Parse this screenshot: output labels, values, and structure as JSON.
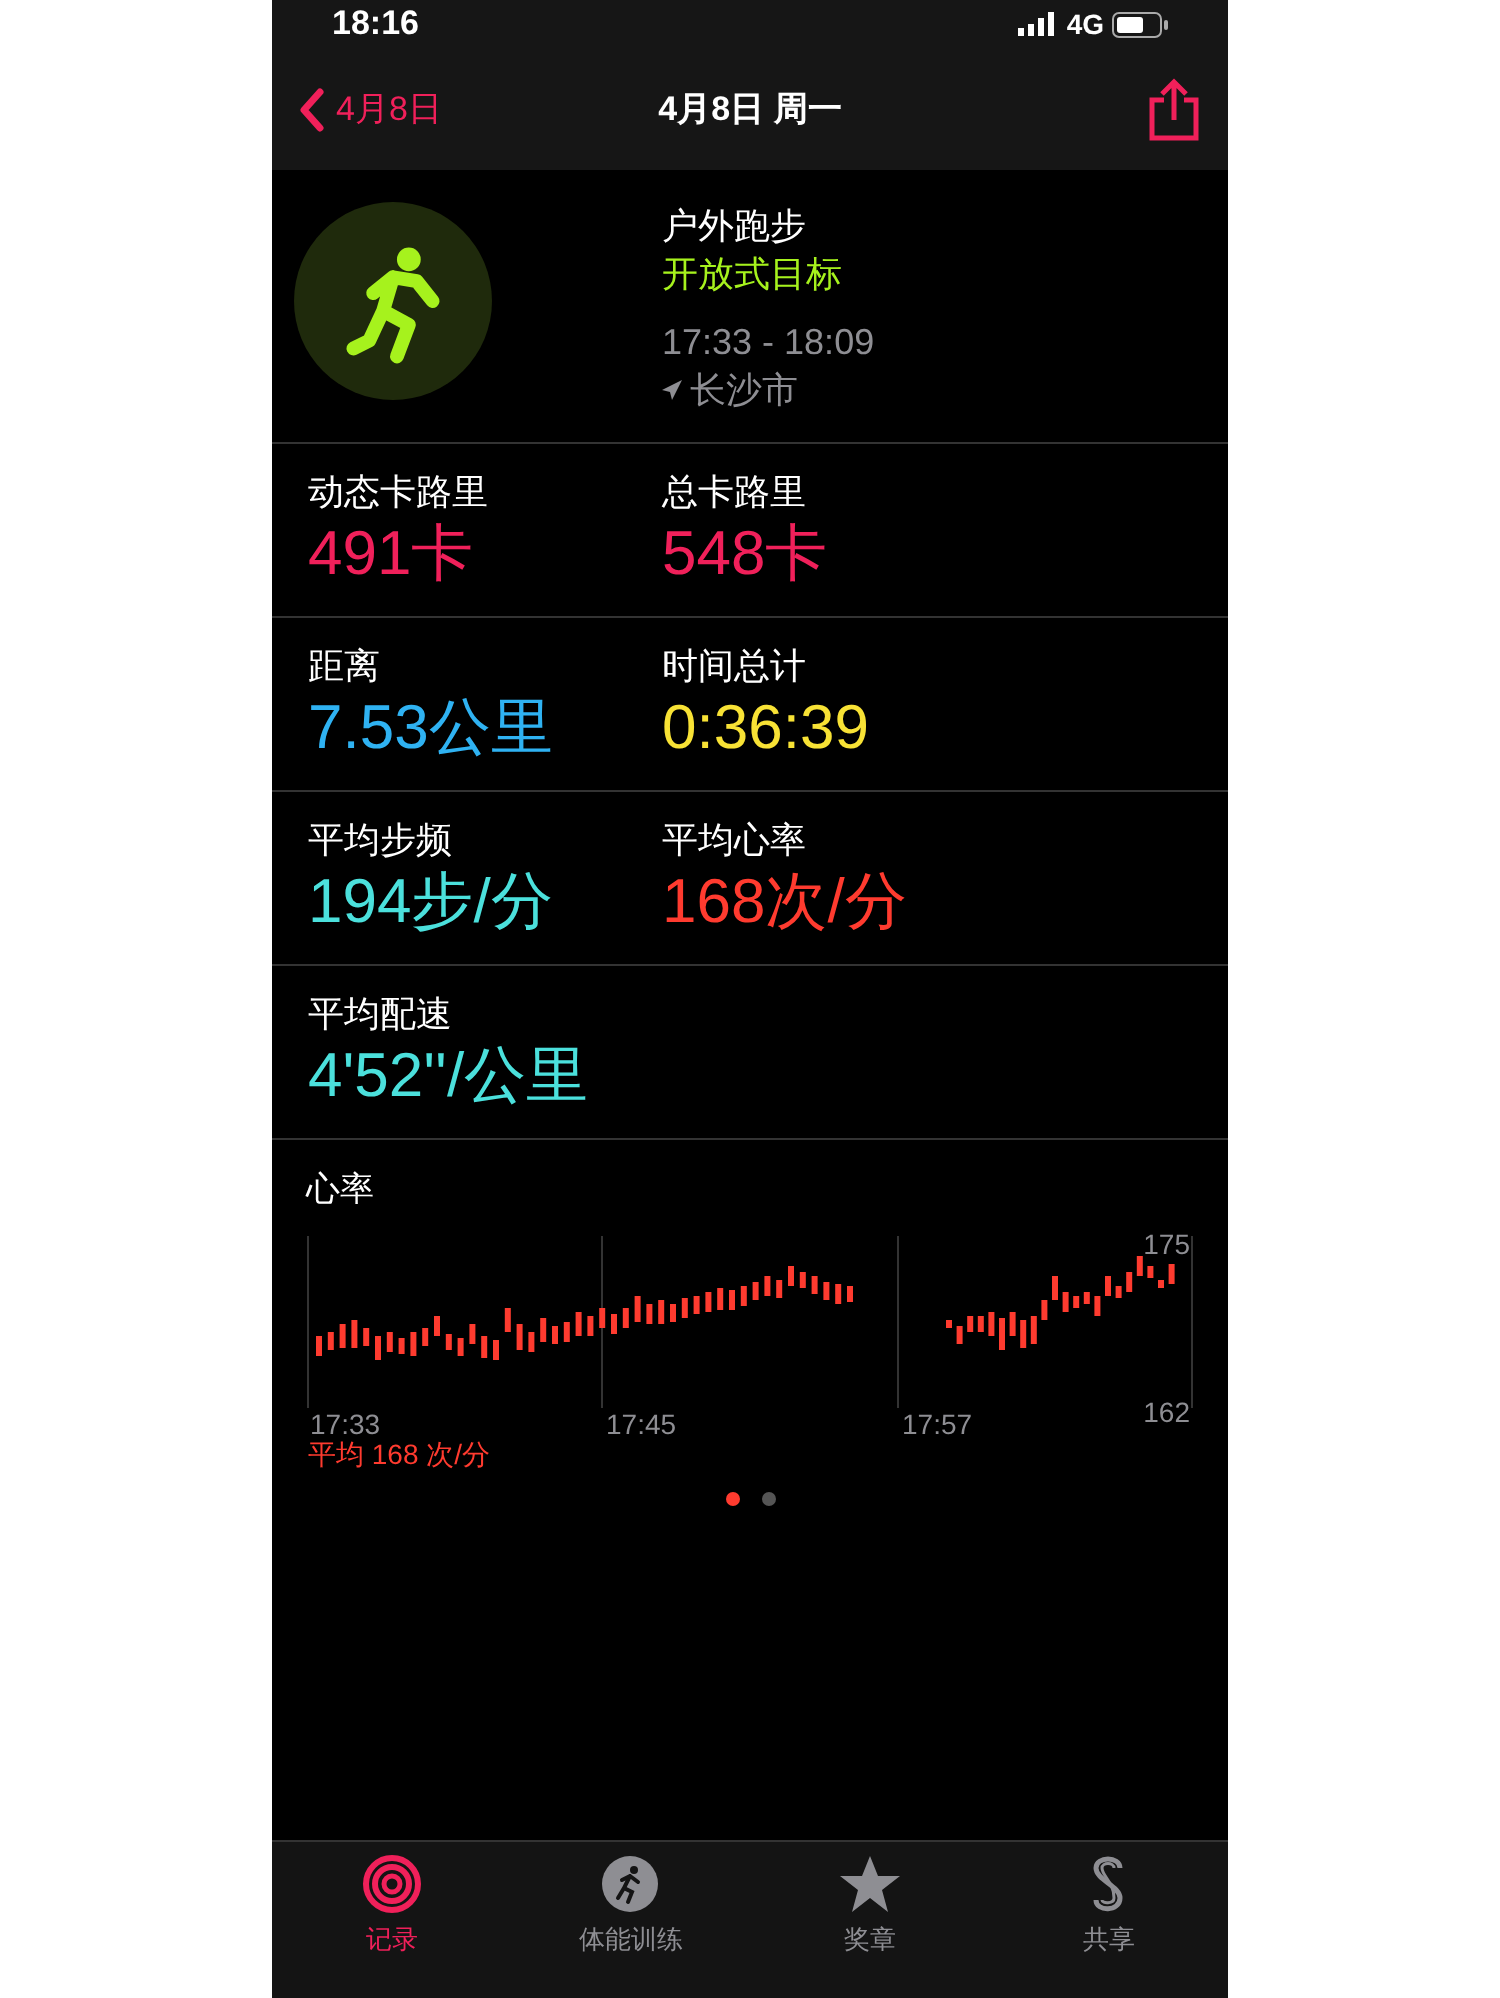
{
  "status_bar": {
    "time": "18:16",
    "network": "4G"
  },
  "nav": {
    "back_label": "4月8日",
    "title": "4月8日 周一"
  },
  "workout": {
    "name": "户外跑步",
    "goal": "开放式目标",
    "time_range": "17:33 - 18:09",
    "location": "长沙市"
  },
  "metrics": [
    {
      "label": "动态卡路里",
      "value": "491卡",
      "color": "#f0205a"
    },
    {
      "label": "总卡路里",
      "value": "548卡",
      "color": "#f0205a"
    },
    {
      "label": "距离",
      "value": "7.53公里",
      "color": "#2fb2f2"
    },
    {
      "label": "时间总计",
      "value": "0:36:39",
      "color": "#f8e235"
    },
    {
      "label": "平均步频",
      "value": "194步/分",
      "color": "#4be0dc"
    },
    {
      "label": "平均心率",
      "value": "168次/分",
      "color": "#ff3b2f"
    },
    {
      "label": "平均配速",
      "value": "4'52''/公里",
      "color": "#4be0dc"
    }
  ],
  "heart_rate": {
    "title": "心率",
    "y_max": "175",
    "y_min": "162",
    "x_labels": [
      "17:33",
      "17:45",
      "17:57"
    ],
    "average": "平均 168 次/分"
  },
  "pager": [
    {
      "selected": true
    },
    {
      "selected": false
    }
  ],
  "tabs": [
    {
      "label": "记录",
      "kind": "rings",
      "selected": true
    },
    {
      "label": "体能训练",
      "kind": "runner",
      "selected": false
    },
    {
      "label": "奖章",
      "kind": "star",
      "selected": false
    },
    {
      "label": "共享",
      "kind": "share",
      "selected": false
    }
  ]
}
